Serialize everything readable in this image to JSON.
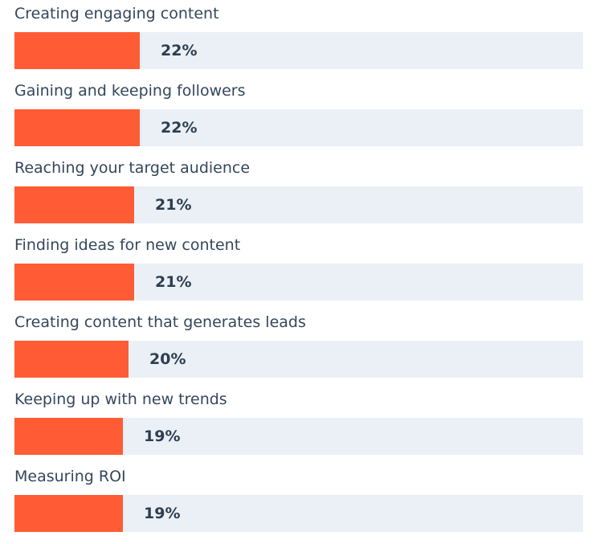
{
  "chart_data": {
    "type": "bar",
    "orientation": "horizontal",
    "categories": [
      "Creating engaging content",
      "Gaining and keeping followers",
      "Reaching your target audience",
      "Finding ideas for new content",
      "Creating content that generates leads",
      "Keeping up with new trends",
      "Measuring ROI"
    ],
    "values": [
      22,
      22,
      21,
      21,
      20,
      19,
      19
    ],
    "value_labels": [
      "22%",
      "22%",
      "21%",
      "21%",
      "20%",
      "19%",
      "19%"
    ],
    "unit": "%",
    "xlim": [
      0,
      100
    ],
    "grid": false,
    "legend": "none"
  },
  "colors": {
    "bar": "#ff5c35",
    "track": "#eaf0f6",
    "label_text": "#33475b",
    "value_text": "#2d3e50"
  }
}
